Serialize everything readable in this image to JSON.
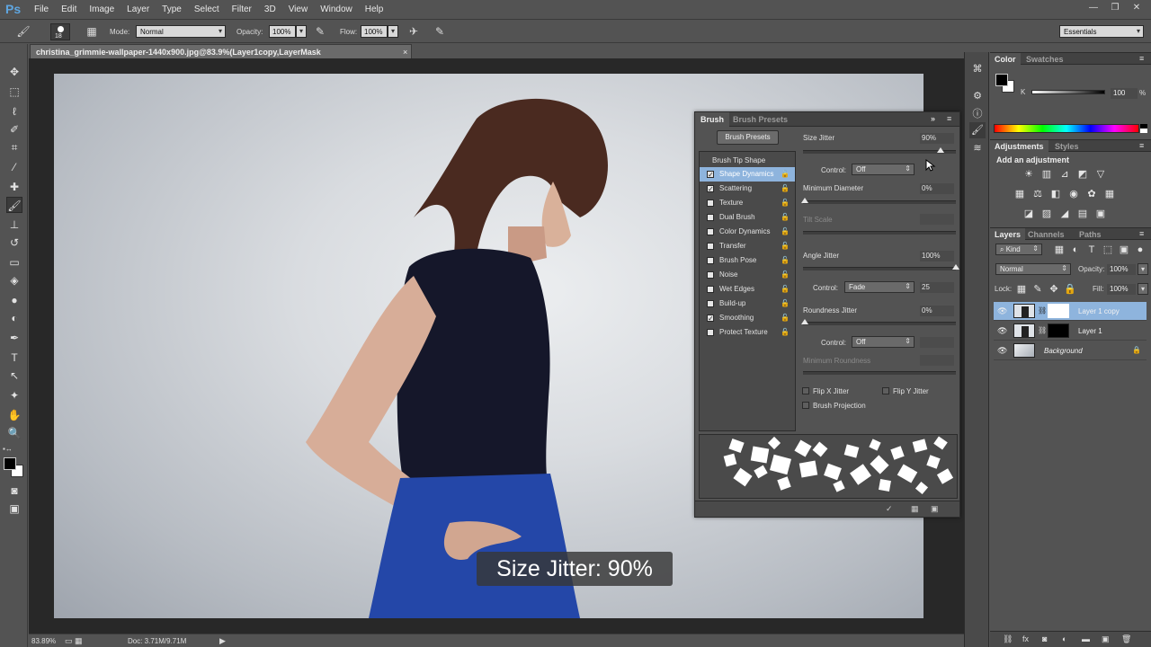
{
  "app": {
    "logo": "Ps"
  },
  "menu": [
    "File",
    "Edit",
    "Image",
    "Layer",
    "Type",
    "Select",
    "Filter",
    "3D",
    "View",
    "Window",
    "Help"
  ],
  "window_controls": {
    "minimize": "—",
    "restore": "❐",
    "close": "✕"
  },
  "options": {
    "brush_size": "18",
    "mode_label": "Mode:",
    "mode_value": "Normal",
    "opacity_label": "Opacity:",
    "opacity_value": "100%",
    "flow_label": "Flow:",
    "flow_value": "100%",
    "workspace": "Essentials"
  },
  "document": {
    "tab_title": "christina_grimmie-wallpaper-1440x900.jpg@83.9%(Layer1copy,LayerMask",
    "tab_close": "×",
    "zoom": "83.89%",
    "doc_size": "Doc: 3.71M/9.71M"
  },
  "caption": "Size Jitter: 90%",
  "brush_panel": {
    "tab_brush": "Brush",
    "tab_presets": "Brush Presets",
    "presets_button": "Brush Presets",
    "items": [
      {
        "label": "Brush Tip Shape",
        "checked": null
      },
      {
        "label": "Shape Dynamics",
        "checked": true,
        "selected": true
      },
      {
        "label": "Scattering",
        "checked": true
      },
      {
        "label": "Texture",
        "checked": false
      },
      {
        "label": "Dual Brush",
        "checked": false
      },
      {
        "label": "Color Dynamics",
        "checked": false
      },
      {
        "label": "Transfer",
        "checked": false
      },
      {
        "label": "Brush Pose",
        "checked": false
      },
      {
        "label": "Noise",
        "checked": false
      },
      {
        "label": "Wet Edges",
        "checked": false
      },
      {
        "label": "Build-up",
        "checked": false
      },
      {
        "label": "Smoothing",
        "checked": true
      },
      {
        "label": "Protect Texture",
        "checked": false
      }
    ],
    "size_jitter_label": "Size Jitter",
    "size_jitter_value": "90%",
    "control_label": "Control:",
    "control_value": "Off",
    "min_diameter_label": "Minimum Diameter",
    "min_diameter_value": "0%",
    "tilt_scale_label": "Tilt Scale",
    "angle_jitter_label": "Angle Jitter",
    "angle_jitter_value": "100%",
    "angle_control_label": "Control:",
    "angle_control_value": "Fade",
    "fade_steps": "25",
    "roundness_jitter_label": "Roundness Jitter",
    "roundness_jitter_value": "0%",
    "roundness_control_label": "Control:",
    "roundness_control_value": "Off",
    "min_roundness_label": "Minimum Roundness",
    "flip_x_label": "Flip X Jitter",
    "flip_y_label": "Flip Y Jitter",
    "brush_projection_label": "Brush Projection",
    "size_jitter_level": 0.9,
    "angle_jitter_level": 1.0,
    "lock_icon": "🔒"
  },
  "color_panel": {
    "tab_color": "Color",
    "tab_swatches": "Swatches",
    "channel_label": "K",
    "channel_value": "100",
    "channel_unit": "%"
  },
  "adjustments_panel": {
    "tab_adjustments": "Adjustments",
    "tab_styles": "Styles",
    "title": "Add an adjustment"
  },
  "layers_panel": {
    "tab_layers": "Layers",
    "tab_channels": "Channels",
    "tab_paths": "Paths",
    "kind_label": "Kind",
    "blend_mode": "Normal",
    "opacity_label": "Opacity:",
    "opacity_value": "100%",
    "lock_label": "Lock:",
    "fill_label": "Fill:",
    "fill_value": "100%",
    "layers": [
      {
        "name": "Layer 1 copy",
        "selected": true
      },
      {
        "name": "Layer 1",
        "selected": false
      },
      {
        "name": "Background",
        "selected": false
      }
    ]
  },
  "colors": {
    "selection": "#8eb4dd",
    "panel_bg": "#535353",
    "skirt_blue": "#2447a8"
  }
}
